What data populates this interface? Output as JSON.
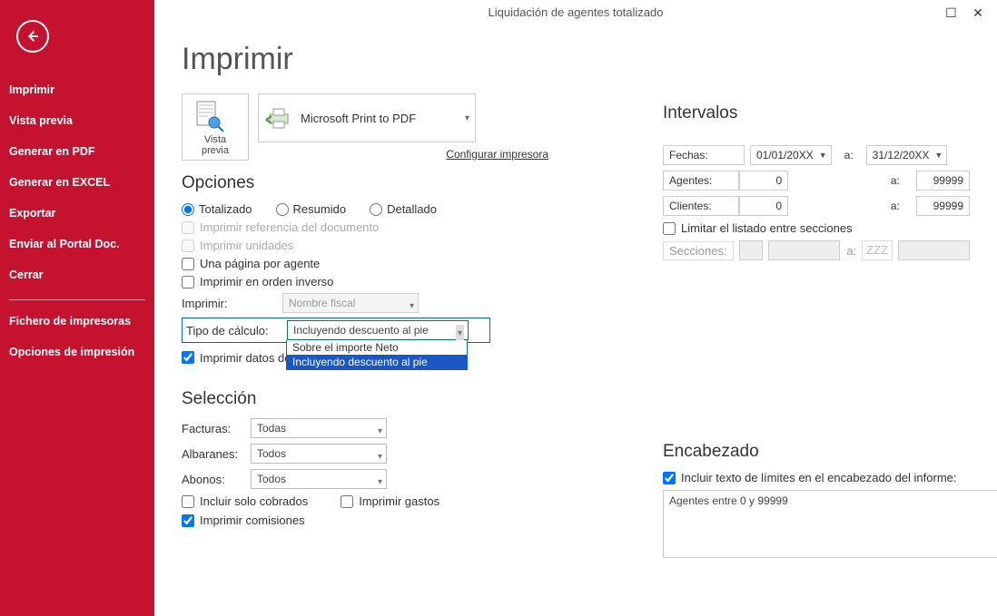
{
  "titlebar": {
    "title": "Liquidación de agentes totalizado"
  },
  "sidebar": {
    "items": [
      "Imprimir",
      "Vista previa",
      "Generar en PDF",
      "Generar en EXCEL",
      "Exportar",
      "Enviar al Portal Doc.",
      "Cerrar"
    ],
    "extra": [
      "Fichero de impresoras",
      "Opciones de impresión"
    ]
  },
  "main": {
    "title": "Imprimir",
    "preview_label": "Vista previa",
    "printer_name": "Microsoft Print to PDF",
    "config_link": "Configurar impresora"
  },
  "opciones": {
    "heading": "Opciones",
    "radios": {
      "totalizado": "Totalizado",
      "resumido": "Resumido",
      "detallado": "Detallado"
    },
    "chk_ref": "Imprimir referencia del documento",
    "chk_uni": "Imprimir unidades",
    "chk_pagina": "Una página por agente",
    "chk_orden": "Imprimir en orden inverso",
    "imprimir_label": "Imprimir:",
    "imprimir_value": "Nombre fiscal",
    "tipo_label": "Tipo de cálculo:",
    "tipo_value": "Incluyendo descuento al pie",
    "tipo_options": [
      "Sobre el importe Neto",
      "Incluyendo descuento al pie"
    ],
    "chk_datos": "Imprimir datos de"
  },
  "seleccion": {
    "heading": "Selección",
    "facturas": {
      "label": "Facturas:",
      "value": "Todas"
    },
    "albaranes": {
      "label": "Albaranes:",
      "value": "Todos"
    },
    "abonos": {
      "label": "Abonos:",
      "value": "Todos"
    },
    "chk_cobrados": "Incluir solo cobrados",
    "chk_gastos": "Imprimir gastos",
    "chk_comisiones": "Imprimir comisiones"
  },
  "intervalos": {
    "heading": "Intervalos",
    "fechas_label": "Fechas:",
    "fechas_from": "01/01/20XX",
    "fechas_to": "31/12/20XX",
    "a": "a:",
    "agentes_label": "Agentes:",
    "agentes_from": "0",
    "agentes_to": "99999",
    "clientes_label": "Clientes:",
    "clientes_from": "0",
    "clientes_to": "99999",
    "chk_limitar": "Limitar el listado entre secciones",
    "secciones_label": "Secciones:",
    "secciones_to": "ZZZ"
  },
  "encabezado": {
    "heading": "Encabezado",
    "chk_incluir": "Incluir texto de límites en el encabezado del informe:",
    "text": "Agentes entre 0 y 99999"
  }
}
